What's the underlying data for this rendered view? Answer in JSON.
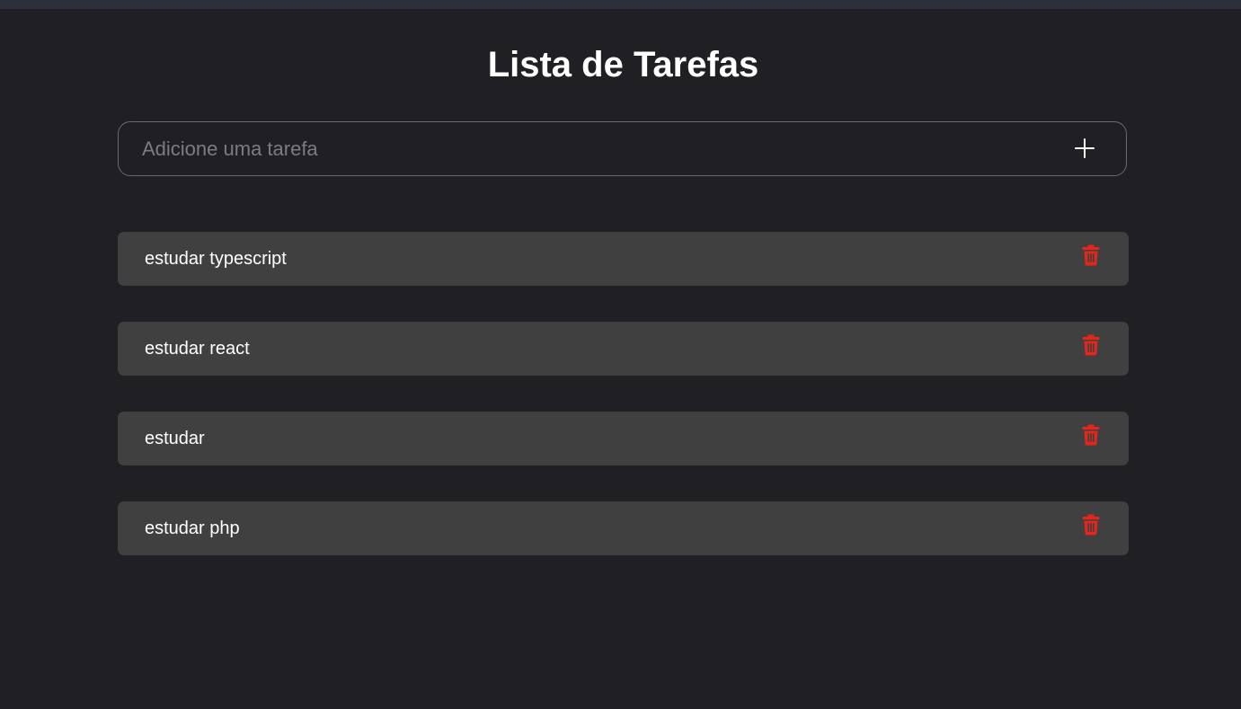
{
  "app": {
    "title": "Lista de Tarefas"
  },
  "add_form": {
    "placeholder": "Adicione uma tarefa",
    "value": "",
    "add_icon": "plus-icon"
  },
  "tasks": [
    {
      "label": "estudar typescript",
      "delete_icon": "trash-icon"
    },
    {
      "label": "estudar react",
      "delete_icon": "trash-icon"
    },
    {
      "label": "estudar",
      "delete_icon": "trash-icon"
    },
    {
      "label": "estudar php",
      "delete_icon": "trash-icon"
    }
  ],
  "colors": {
    "background": "#202024",
    "card": "#404040",
    "delete": "#e8251b",
    "text": "#ffffff",
    "placeholder": "#7c7c80"
  }
}
